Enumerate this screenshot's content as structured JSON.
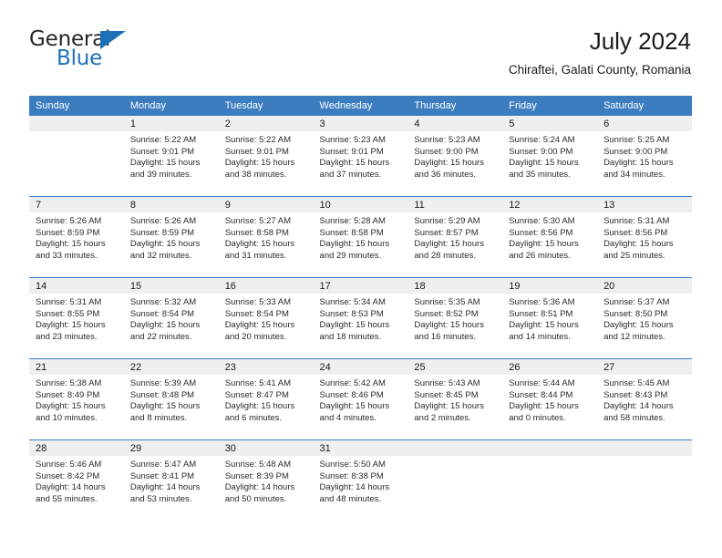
{
  "brand": {
    "name_part1": "General",
    "name_part2": "Blue",
    "triangle_color": "#1d70b8"
  },
  "header": {
    "title": "July 2024",
    "subtitle": "Chiraftei, Galati County, Romania"
  },
  "theme": {
    "header_bg": "#3b7dbf",
    "daynum_bg": "#efefef",
    "separator": "#3b7dbf"
  },
  "weekday_headers": [
    "Sunday",
    "Monday",
    "Tuesday",
    "Wednesday",
    "Thursday",
    "Friday",
    "Saturday"
  ],
  "labels": {
    "sunrise_prefix": "Sunrise:",
    "sunset_prefix": "Sunset:",
    "daylight_prefix": "Daylight:"
  },
  "weeks": [
    [
      {
        "day": "",
        "empty": true,
        "line1": "",
        "line2": "",
        "line3": "",
        "line4": ""
      },
      {
        "day": "1",
        "line1": "Sunrise: 5:22 AM",
        "line2": "Sunset: 9:01 PM",
        "line3": "Daylight: 15 hours",
        "line4": "and 39 minutes."
      },
      {
        "day": "2",
        "line1": "Sunrise: 5:22 AM",
        "line2": "Sunset: 9:01 PM",
        "line3": "Daylight: 15 hours",
        "line4": "and 38 minutes."
      },
      {
        "day": "3",
        "line1": "Sunrise: 5:23 AM",
        "line2": "Sunset: 9:01 PM",
        "line3": "Daylight: 15 hours",
        "line4": "and 37 minutes."
      },
      {
        "day": "4",
        "line1": "Sunrise: 5:23 AM",
        "line2": "Sunset: 9:00 PM",
        "line3": "Daylight: 15 hours",
        "line4": "and 36 minutes."
      },
      {
        "day": "5",
        "line1": "Sunrise: 5:24 AM",
        "line2": "Sunset: 9:00 PM",
        "line3": "Daylight: 15 hours",
        "line4": "and 35 minutes."
      },
      {
        "day": "6",
        "line1": "Sunrise: 5:25 AM",
        "line2": "Sunset: 9:00 PM",
        "line3": "Daylight: 15 hours",
        "line4": "and 34 minutes."
      }
    ],
    [
      {
        "day": "7",
        "line1": "Sunrise: 5:26 AM",
        "line2": "Sunset: 8:59 PM",
        "line3": "Daylight: 15 hours",
        "line4": "and 33 minutes."
      },
      {
        "day": "8",
        "line1": "Sunrise: 5:26 AM",
        "line2": "Sunset: 8:59 PM",
        "line3": "Daylight: 15 hours",
        "line4": "and 32 minutes."
      },
      {
        "day": "9",
        "line1": "Sunrise: 5:27 AM",
        "line2": "Sunset: 8:58 PM",
        "line3": "Daylight: 15 hours",
        "line4": "and 31 minutes."
      },
      {
        "day": "10",
        "line1": "Sunrise: 5:28 AM",
        "line2": "Sunset: 8:58 PM",
        "line3": "Daylight: 15 hours",
        "line4": "and 29 minutes."
      },
      {
        "day": "11",
        "line1": "Sunrise: 5:29 AM",
        "line2": "Sunset: 8:57 PM",
        "line3": "Daylight: 15 hours",
        "line4": "and 28 minutes."
      },
      {
        "day": "12",
        "line1": "Sunrise: 5:30 AM",
        "line2": "Sunset: 8:56 PM",
        "line3": "Daylight: 15 hours",
        "line4": "and 26 minutes."
      },
      {
        "day": "13",
        "line1": "Sunrise: 5:31 AM",
        "line2": "Sunset: 8:56 PM",
        "line3": "Daylight: 15 hours",
        "line4": "and 25 minutes."
      }
    ],
    [
      {
        "day": "14",
        "line1": "Sunrise: 5:31 AM",
        "line2": "Sunset: 8:55 PM",
        "line3": "Daylight: 15 hours",
        "line4": "and 23 minutes."
      },
      {
        "day": "15",
        "line1": "Sunrise: 5:32 AM",
        "line2": "Sunset: 8:54 PM",
        "line3": "Daylight: 15 hours",
        "line4": "and 22 minutes."
      },
      {
        "day": "16",
        "line1": "Sunrise: 5:33 AM",
        "line2": "Sunset: 8:54 PM",
        "line3": "Daylight: 15 hours",
        "line4": "and 20 minutes."
      },
      {
        "day": "17",
        "line1": "Sunrise: 5:34 AM",
        "line2": "Sunset: 8:53 PM",
        "line3": "Daylight: 15 hours",
        "line4": "and 18 minutes."
      },
      {
        "day": "18",
        "line1": "Sunrise: 5:35 AM",
        "line2": "Sunset: 8:52 PM",
        "line3": "Daylight: 15 hours",
        "line4": "and 16 minutes."
      },
      {
        "day": "19",
        "line1": "Sunrise: 5:36 AM",
        "line2": "Sunset: 8:51 PM",
        "line3": "Daylight: 15 hours",
        "line4": "and 14 minutes."
      },
      {
        "day": "20",
        "line1": "Sunrise: 5:37 AM",
        "line2": "Sunset: 8:50 PM",
        "line3": "Daylight: 15 hours",
        "line4": "and 12 minutes."
      }
    ],
    [
      {
        "day": "21",
        "line1": "Sunrise: 5:38 AM",
        "line2": "Sunset: 8:49 PM",
        "line3": "Daylight: 15 hours",
        "line4": "and 10 minutes."
      },
      {
        "day": "22",
        "line1": "Sunrise: 5:39 AM",
        "line2": "Sunset: 8:48 PM",
        "line3": "Daylight: 15 hours",
        "line4": "and 8 minutes."
      },
      {
        "day": "23",
        "line1": "Sunrise: 5:41 AM",
        "line2": "Sunset: 8:47 PM",
        "line3": "Daylight: 15 hours",
        "line4": "and 6 minutes."
      },
      {
        "day": "24",
        "line1": "Sunrise: 5:42 AM",
        "line2": "Sunset: 8:46 PM",
        "line3": "Daylight: 15 hours",
        "line4": "and 4 minutes."
      },
      {
        "day": "25",
        "line1": "Sunrise: 5:43 AM",
        "line2": "Sunset: 8:45 PM",
        "line3": "Daylight: 15 hours",
        "line4": "and 2 minutes."
      },
      {
        "day": "26",
        "line1": "Sunrise: 5:44 AM",
        "line2": "Sunset: 8:44 PM",
        "line3": "Daylight: 15 hours",
        "line4": "and 0 minutes."
      },
      {
        "day": "27",
        "line1": "Sunrise: 5:45 AM",
        "line2": "Sunset: 8:43 PM",
        "line3": "Daylight: 14 hours",
        "line4": "and 58 minutes."
      }
    ],
    [
      {
        "day": "28",
        "line1": "Sunrise: 5:46 AM",
        "line2": "Sunset: 8:42 PM",
        "line3": "Daylight: 14 hours",
        "line4": "and 55 minutes."
      },
      {
        "day": "29",
        "line1": "Sunrise: 5:47 AM",
        "line2": "Sunset: 8:41 PM",
        "line3": "Daylight: 14 hours",
        "line4": "and 53 minutes."
      },
      {
        "day": "30",
        "line1": "Sunrise: 5:48 AM",
        "line2": "Sunset: 8:39 PM",
        "line3": "Daylight: 14 hours",
        "line4": "and 50 minutes."
      },
      {
        "day": "31",
        "line1": "Sunrise: 5:50 AM",
        "line2": "Sunset: 8:38 PM",
        "line3": "Daylight: 14 hours",
        "line4": "and 48 minutes."
      },
      {
        "day": "",
        "empty": true,
        "line1": "",
        "line2": "",
        "line3": "",
        "line4": ""
      },
      {
        "day": "",
        "empty": true,
        "line1": "",
        "line2": "",
        "line3": "",
        "line4": ""
      },
      {
        "day": "",
        "empty": true,
        "line1": "",
        "line2": "",
        "line3": "",
        "line4": ""
      }
    ]
  ]
}
